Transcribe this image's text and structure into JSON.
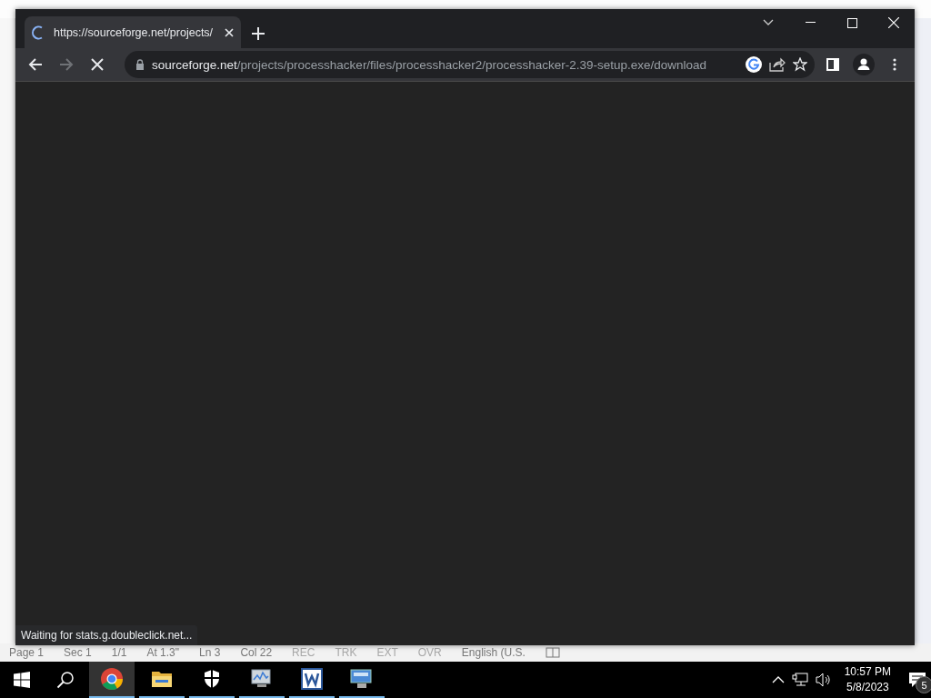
{
  "word_window": {
    "status_bar": [
      {
        "text": "Page 1",
        "disabled": false
      },
      {
        "text": "Sec 1",
        "disabled": false
      },
      {
        "text": "1/1",
        "disabled": false
      },
      {
        "text": "At 1.3\"",
        "disabled": false
      },
      {
        "text": "Ln 3",
        "disabled": false
      },
      {
        "text": "Col 22",
        "disabled": false
      },
      {
        "text": "REC",
        "disabled": true
      },
      {
        "text": "TRK",
        "disabled": true
      },
      {
        "text": "EXT",
        "disabled": true
      },
      {
        "text": "OVR",
        "disabled": true
      },
      {
        "text": "English (U.S.",
        "disabled": false
      }
    ]
  },
  "browser": {
    "loading": true,
    "tabs": [
      {
        "title": "https://sourceforge.net/projects/",
        "selected": true
      }
    ],
    "address": {
      "domain": "sourceforge.net",
      "path": "/projects/processhacker/files/processhacker2/processhacker-2.39-setup.exe/download"
    },
    "status": "Waiting for stats.g.doubleclick.net..."
  },
  "taskbar": {
    "apps": [
      {
        "kind": "chrome",
        "selected": true
      },
      {
        "kind": "folder",
        "selected": false
      },
      {
        "kind": "shield",
        "selected": false
      },
      {
        "kind": "monitor",
        "selected": false
      },
      {
        "kind": "word",
        "selected": false
      },
      {
        "kind": "computer",
        "selected": false
      }
    ],
    "clock": {
      "time": "10:57 PM",
      "date": "5/8/2023"
    },
    "notifications": "5"
  }
}
